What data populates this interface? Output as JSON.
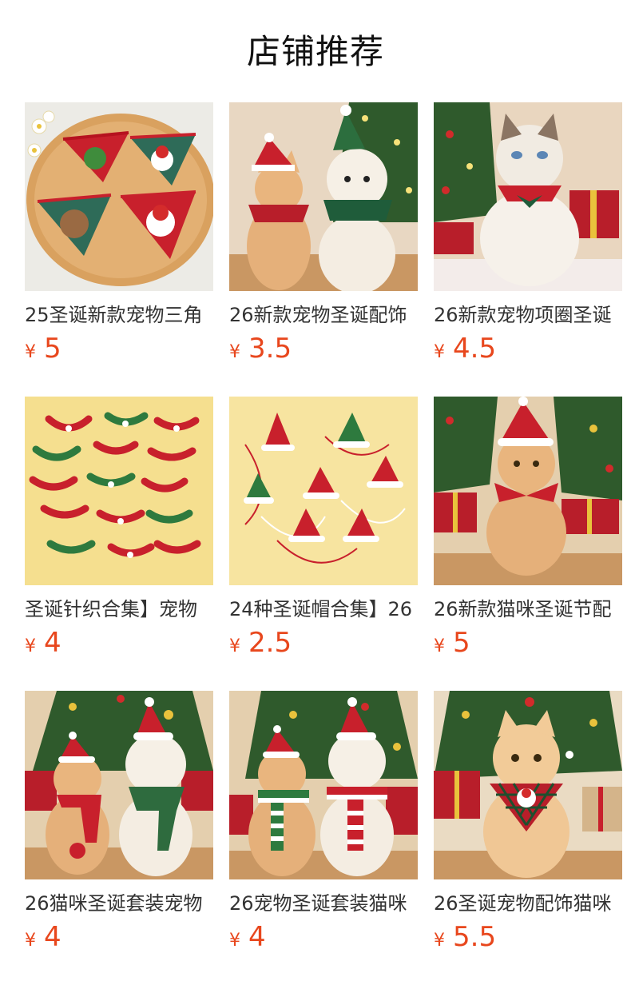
{
  "page": {
    "title": "店铺推荐"
  },
  "currency_symbol": "¥",
  "colors": {
    "price": "#e8471d",
    "title": "#111111",
    "name": "#333333"
  },
  "products": [
    {
      "name": "25圣诞新款宠物三角",
      "price": "5",
      "image": "bandana-set-on-wooden-tray"
    },
    {
      "name": "26新款宠物圣诞配饰",
      "price": "3.5",
      "image": "cat-and-dog-with-christmas-hats"
    },
    {
      "name": "26新款宠物项圈圣诞",
      "price": "4.5",
      "image": "ragdoll-cat-with-plaid-bow-collar"
    },
    {
      "name": "圣诞针织合集】宠物",
      "price": "4",
      "image": "knitted-christmas-collars-collection"
    },
    {
      "name": "24种圣诞帽合集】26",
      "price": "2.5",
      "image": "knitted-christmas-hats-collection"
    },
    {
      "name": "26新款猫咪圣诞节配",
      "price": "5",
      "image": "cat-with-santa-hat-and-bow"
    },
    {
      "name": "26猫咪圣诞套装宠物",
      "price": "4",
      "image": "cat-and-dog-with-knit-scarves"
    },
    {
      "name": "26宠物圣诞套装猫咪",
      "price": "4",
      "image": "cat-and-dog-with-striped-scarves"
    },
    {
      "name": "26圣诞宠物配饰猫咪",
      "price": "5.5",
      "image": "cat-with-plaid-santa-bandana"
    }
  ]
}
